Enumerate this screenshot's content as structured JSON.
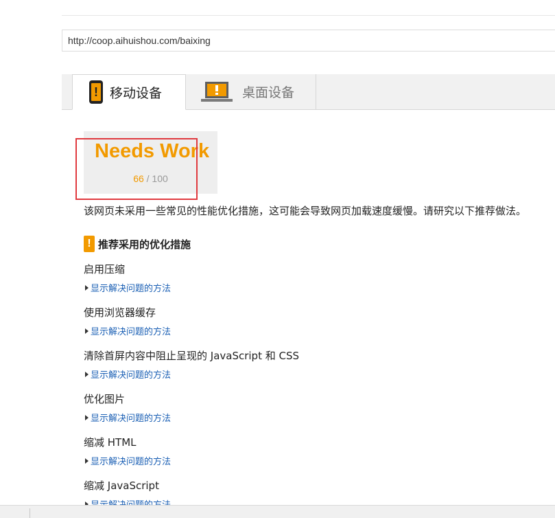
{
  "url": "http://coop.aihuishou.com/baixing",
  "tabs": [
    {
      "label": "移动设备",
      "icon": "mobile-phone-icon",
      "active": true
    },
    {
      "label": "桌面设备",
      "icon": "laptop-icon",
      "active": false
    }
  ],
  "score": {
    "label": "Needs Work",
    "value": "66",
    "max": "/ 100",
    "color": "#f29a00"
  },
  "summary": "该网页未采用一些常见的性能优化措施，这可能会导致网页加载速度缓慢。请研究以下推荐做法。",
  "section": {
    "icon_glyph": "!",
    "title": "推荐采用的优化措施"
  },
  "link_label": "显示解决问题的方法",
  "rules": [
    {
      "title": "启用压缩",
      "link": "显示解决问题的方法"
    },
    {
      "title": "使用浏览器缓存",
      "link": "显示解决问题的方法"
    },
    {
      "title": "清除首屏内容中阻止呈现的 JavaScript 和 CSS",
      "link": "显示解决问题的方法"
    },
    {
      "title": "优化图片",
      "link": "显示解决问题的方法"
    },
    {
      "title": "缩减 HTML",
      "link": "显示解决问题的方法"
    },
    {
      "title": "缩减 JavaScript",
      "link": "显示解决问题的方法"
    }
  ]
}
